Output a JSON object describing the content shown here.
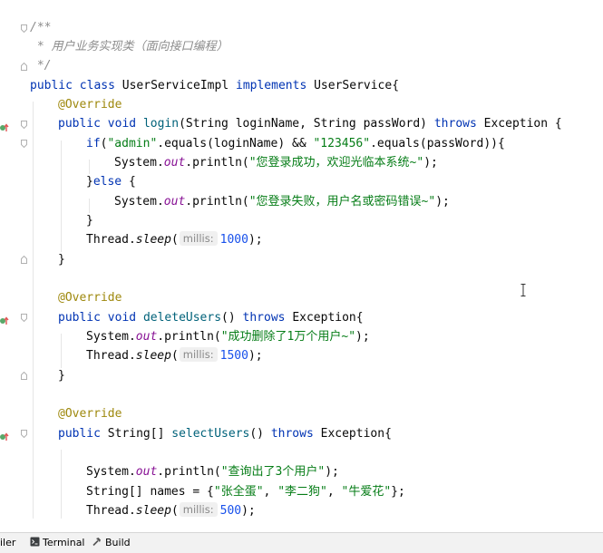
{
  "editor": {
    "doc_comment": {
      "open": "/**",
      "text_prefix": " * ",
      "text": "用户业务实现类（面向接口编程）",
      "close": " */"
    },
    "class_decl": {
      "kw_public": "public",
      "kw_class": "class",
      "class_name": "UserServiceImpl",
      "kw_implements": "implements",
      "interface": "UserService",
      "brace": "{"
    },
    "login": {
      "annotation": "@Override",
      "kw_public": "public",
      "kw_void": "void",
      "name": "login",
      "params": "(String loginName, String passWord)",
      "kw_throws": "throws",
      "exception": "Exception {",
      "if_kw": "if",
      "if_open": "(",
      "admin_str": "\"admin\"",
      "if_mid": ".equals(loginName) && ",
      "pwd_str": "\"123456\"",
      "if_end": ".equals(passWord)){",
      "sys": "System.",
      "out": "out",
      "println": ".println(",
      "ok_msg": "\"您登录成功，欢迎光临本系统~\"",
      "end": ");",
      "else_open": "}",
      "else_kw": "else",
      "else_brace": " {",
      "fail_msg": "\"您登录失败，用户名或密码错误~\"",
      "close_if": "}",
      "thread": "Thread.",
      "sleep": "sleep",
      "paren_open": "(",
      "hint": "millis:",
      "sleep_value": "1000",
      "close_method": "}"
    },
    "delete": {
      "annotation": "@Override",
      "kw_public": "public",
      "kw_void": "void",
      "name": "deleteUsers",
      "parens": "()",
      "kw_throws": "throws",
      "exception": "Exception{",
      "msg": "\"成功删除了1万个用户~\"",
      "sleep_value": "1500",
      "close_method": "}"
    },
    "select": {
      "annotation": "@Override",
      "kw_public": "public",
      "return_type": "String[]",
      "name": "selectUsers",
      "parens": "()",
      "kw_throws": "throws",
      "exception": "Exception{",
      "msg": "\"查询出了3个用户\"",
      "arr_decl": "String[] names = {",
      "name1": "\"张全蛋\"",
      "comma": ", ",
      "name2": "\"李二狗\"",
      "name3": "\"牛爱花\"",
      "arr_end": "};",
      "sleep_value": "500"
    }
  },
  "statusbar": {
    "left_cut": "iler",
    "terminal": "Terminal",
    "build": "Build"
  },
  "colors": {
    "keyword": "#0033b3",
    "string": "#067d17",
    "number": "#1750eb",
    "annotation": "#9e880d",
    "comment": "#8c8c8c",
    "static_field": "#871094"
  },
  "icons": [
    "fold-marker-icon",
    "implementing-method-icon",
    "text-cursor-icon",
    "terminal-icon",
    "hammer-icon"
  ]
}
